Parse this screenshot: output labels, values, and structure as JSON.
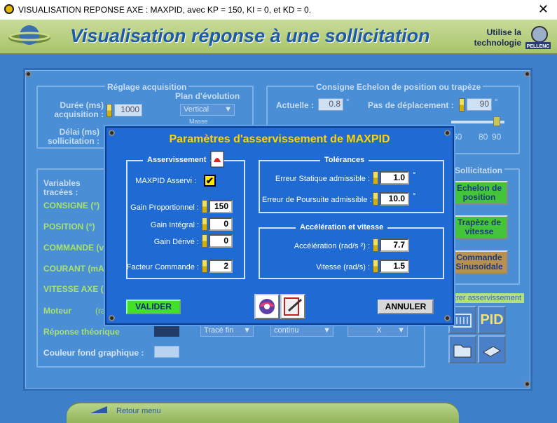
{
  "window": {
    "title": "VISUALISATION REPONSE AXE : MAXPID, avec KP = 150, KI = 0, et KD = 0.",
    "close": "✕"
  },
  "banner": {
    "title": "Visualisation réponse à une sollicitation",
    "utilise": "Utilise la",
    "technologie": "technologie",
    "logo": "PELLENC"
  },
  "acq": {
    "title": "Réglage acquisition",
    "duree_label": "Durée (ms)\nacquisition :",
    "duree_value": "1000",
    "delai_label": "Délai (ms)\nsollicitation :",
    "plan_label": "Plan d'évolution",
    "plan_value": "Vertical",
    "masse": "Masse"
  },
  "consigne": {
    "title": "Consigne Echelon de position ou trapèze",
    "actuelle_label": "Actuelle :",
    "actuelle_value": "0.8",
    "deg1": "°",
    "pas_label": "Pas de déplacement :",
    "pas_value": "90",
    "deg2": "°",
    "ticks": [
      "60",
      "80",
      "90"
    ]
  },
  "vars": {
    "header": "Variables\ntracées :",
    "items": [
      "CONSIGNE (°)",
      "POSITION (°)",
      "COMMANDE (v",
      "COURANT (mA)",
      "VITESSE AXE (",
      "Moteur",
      "Réponse théorique"
    ],
    "moteur_unit": "(ra",
    "couleur": "Couleur fond graphique :",
    "trace": "Tracé fin",
    "continu": "continu",
    "x": "X"
  },
  "sollicitation": {
    "title": "Sollicitation",
    "echelon": "Echelon de\nposition",
    "trapeze": "Trapèze de\nvitesse",
    "commande": "Commande\nSinusoïdale",
    "params": "ètrer asservissement",
    "pid": "PID"
  },
  "footer": {
    "retour": "Retour menu"
  },
  "dialog": {
    "title": "Paramètres d'asservissement de MAXPID",
    "asserv": {
      "title": "Asservissement",
      "asservi_label": "MAXPID Asservi :",
      "kp_label": "Gain Proportionnel :",
      "kp": "150",
      "ki_label": "Gain Intégral :",
      "ki": "0",
      "kd_label": "Gain Dérivé :",
      "kd": "0",
      "fc_label": "Facteur Commande :",
      "fc": "2"
    },
    "tol": {
      "title": "Tolérances",
      "stat_label": "Erreur Statique admissible :",
      "stat": "1.0",
      "pours_label": "Erreur de Poursuite admissible :",
      "pours": "10.0",
      "deg": "°"
    },
    "accel": {
      "title": "Accélération et vitesse",
      "acc_label": "Accélération (rad/s ²) :",
      "acc": "7.7",
      "vit_label": "Vitesse (rad/s) :",
      "vit": "1.5"
    },
    "valider": "VALIDER",
    "annuler": "ANNULER"
  },
  "colors": {
    "accent_green": "#43e02a",
    "dialog_blue": "#1f6ad3",
    "title_yellow": "#ffd400"
  }
}
